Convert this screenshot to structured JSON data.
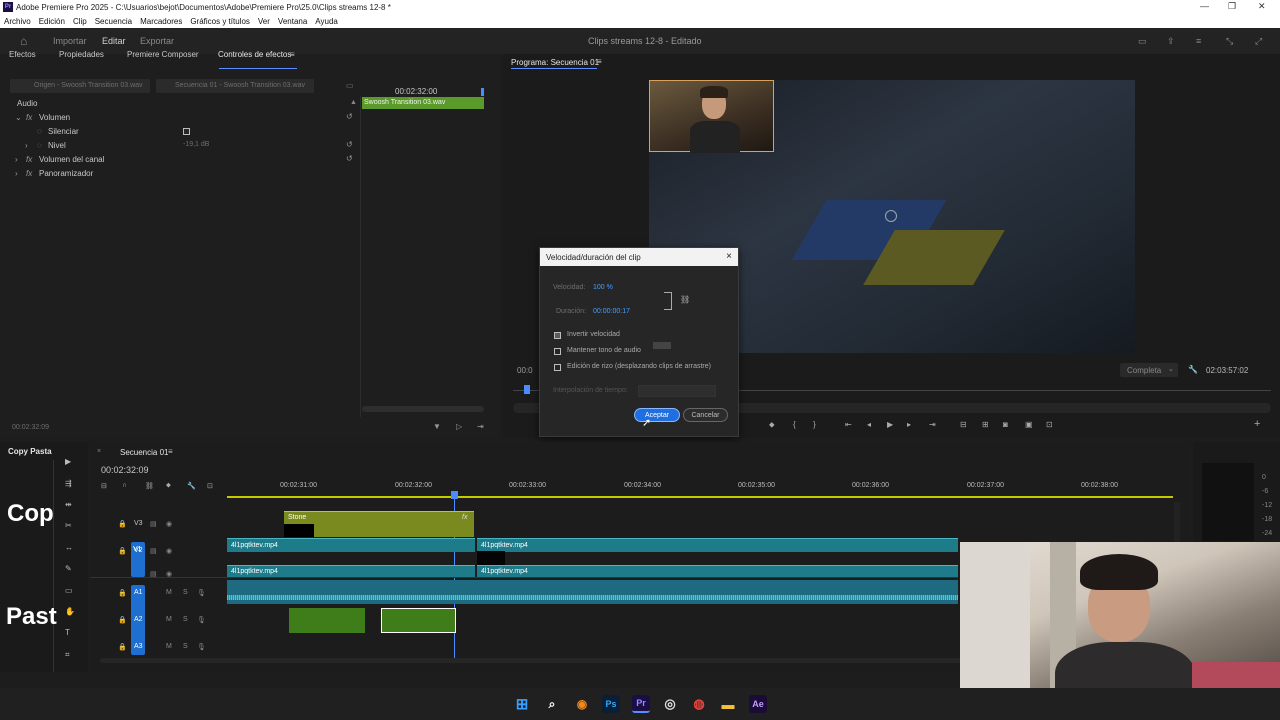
{
  "window": {
    "title": "Adobe Premiere Pro 2025 - C:\\Usuarios\\bejot\\Documentos\\Adobe\\Premiere Pro\\25.0\\Clips streams 12-8 *"
  },
  "menu": [
    "Archivo",
    "Edición",
    "Clip",
    "Secuencia",
    "Marcadores",
    "Gráficos y títulos",
    "Ver",
    "Ventana",
    "Ayuda"
  ],
  "header": {
    "modes": [
      "Importar",
      "Editar",
      "Exportar"
    ],
    "project": "Clips streams 12-8 - Editado"
  },
  "effects_panel": {
    "tabs": [
      "Efectos",
      "Propiedades",
      "Premiere Composer",
      "Controles de efectos"
    ],
    "source_tab": "Origen - Swoosh Transition 03.wav",
    "sequence_tab": "Secuencia 01 - Swoosh Transition 03.wav",
    "timecode_head": "00:02:32:00",
    "clip_label": "Swoosh Transition 03.wav",
    "section": "Audio",
    "rows": [
      {
        "label": "Volumen"
      },
      {
        "label": "Silenciar"
      },
      {
        "label": "Nivel",
        "value": "-19,1 dB"
      },
      {
        "label": "Volumen del canal"
      },
      {
        "label": "Panoramizador"
      }
    ],
    "fx": "fx",
    "footer_time": "00:02:32:09"
  },
  "program": {
    "title": "Programa: Secuencia 01",
    "left_time": "00:0",
    "quality": "Completa",
    "duration": "02:03:57:02"
  },
  "dialog": {
    "title": "Velocidad/duración del clip",
    "speed_label": "Velocidad:",
    "speed_value": "100 %",
    "duration_label": "Duración:",
    "duration_value": "00:00:00:17",
    "opt1": "Invertir velocidad",
    "opt2": "Mantener tono de audio",
    "opt3": "Edición de rizo (desplazando clips de arrastre)",
    "interp_label": "Interpolación de tiempo:",
    "ok": "Aceptar",
    "cancel": "Cancelar",
    "close": "×"
  },
  "timeline": {
    "left_tab": "Copy Pasta",
    "sequence": "Secuencia 01",
    "timecode": "00:02:32:09",
    "ticks": [
      "00:02:31:00",
      "00:02:32:00",
      "00:02:33:00",
      "00:02:34:00",
      "00:02:35:00",
      "00:02:36:00",
      "00:02:37:00",
      "00:02:38:00"
    ],
    "tracks": [
      "V3",
      "V2",
      "A1",
      "A2",
      "A3"
    ],
    "track_v1": "V1",
    "clip_stone": "Stone",
    "clip_video": "4l1pqtktev.mp4",
    "meter_labels": [
      "0",
      "-6",
      "-12",
      "-18",
      "-24",
      "-30"
    ]
  },
  "overlay_text": {
    "top": "Cop",
    "bottom": "Past"
  },
  "taskbar": {
    "icons": [
      "windows-icon",
      "search-icon",
      "blender-icon",
      "photoshop-icon",
      "premiere-icon",
      "obs-icon",
      "chrome-icon",
      "folder-icon",
      "after-effects-icon"
    ],
    "ps": "Ps",
    "pr": "Pr",
    "ae": "Ae"
  }
}
